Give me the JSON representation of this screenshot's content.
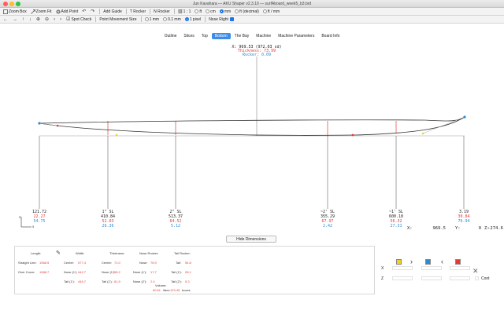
{
  "window": {
    "title": "Jun Kavahara — AKU Shaper v2.3.10 — surfAboard_week5_b3.brd"
  },
  "toolbar1": {
    "zoom_box": "Zoom Box",
    "zoom_fit": "Zoom Fit",
    "add_point": "Add Point",
    "add_guide": "Add Guide",
    "t_rocker": "T Rocker",
    "n_rocker": "N Rocker",
    "scale": "1 : 1",
    "unit_ft": "ft",
    "unit_cm": "cm",
    "unit_mm": "mm",
    "unit_ftdec": "ft (decimal)",
    "unit_ftmm": "ft / mm",
    "selected_unit": "mm"
  },
  "toolbar2": {
    "spot_check": "Spot Check",
    "point_movement": "Point Movement Size",
    "move_1mm": "1 mm",
    "move_01mm": "0.1 mm",
    "move_1px": "1 pixel",
    "nose_right": "Nose Right",
    "selected_move": "1 pixel"
  },
  "tabs": [
    "Outline",
    "Slices",
    "Top",
    "Bottom",
    "The Bay",
    "Machine",
    "Machine Parameters",
    "Board Info"
  ],
  "active_tab": "Bottom",
  "readout": {
    "coords": "X: 969.53 (972.03 sd)",
    "thickness": "Thickness: 73.99",
    "rocker": "Rocker: 0.09"
  },
  "stations": [
    {
      "label": "",
      "v1": "121.72",
      "v2": "22.27",
      "v3": "54.75"
    },
    {
      "label": "1\" SL",
      "v1": "410.84",
      "v2": "52.03",
      "v3": "26.36"
    },
    {
      "label": "2\" SL",
      "v1": "513.37",
      "v2": "64.52",
      "v3": "5.12"
    },
    {
      "label": "~2' SL",
      "v1": "355.29",
      "v2": "67.97",
      "v3": "2.42"
    },
    {
      "label": "~1' SL",
      "v1": "600.18",
      "v2": "56.32",
      "v3": "27.31"
    },
    {
      "label": "",
      "v1": "3.19",
      "v2": "30.84",
      "v3": "76.94"
    }
  ],
  "cursor": {
    "x_label": "X:",
    "x_val": "969.5",
    "y_label": "Y:",
    "y_val": "0",
    "z_label": "Z:",
    "z_val": "-274.6"
  },
  "colors": {
    "accent": "#3d8ce8",
    "red": "#e53935",
    "blue": "#2e8bd0",
    "curve": "#333333"
  },
  "hide_dimensions": "Hide Dimensions",
  "dims": {
    "length": {
      "label": "Length:",
      "straight_line_label": "Straight Line:",
      "straight_line": "1968.5",
      "over_curve_label": "Over Curve:",
      "over_curve": "1988.7"
    },
    "width": {
      "label": "Width:",
      "center_label": "Center:",
      "center": "577.4",
      "nose_label": "Nose (1'):",
      "nose": "442.7",
      "tail_label": "Tail (1'):",
      "tail": "449.7"
    },
    "thickness": {
      "label": "Thickness:",
      "center_label": "Center:",
      "center": "71.0",
      "nose_label": "Nose (1'):",
      "nose": "55.2",
      "tail_label": "Tail (1'):",
      "tail": "61.9"
    },
    "nose_rocker": {
      "label": "Nose Rocker:",
      "nose_label": "Nose:",
      "nose": "76.9",
      "n1_label": "Nose (1'):",
      "n1": "17.7",
      "n2_label": "Nose (2'):",
      "n2": "2.4"
    },
    "tail_rocker": {
      "label": "Tail Rocker:",
      "tail_label": "Tail:",
      "tail": "54.8",
      "t1_label": "Tail (1'):",
      "t1": "28.1",
      "t2_label": "Tail (2'):",
      "t2": "5.3"
    },
    "volume": {
      "label": "Volume:",
      "value": "50.61",
      "liters_label": "liters",
      "boxes_value": "123.45",
      "boxes_label": "boxes"
    }
  },
  "rpanel": {
    "x_label": "X",
    "z_label": "Z",
    "cont_label": "Cont"
  }
}
